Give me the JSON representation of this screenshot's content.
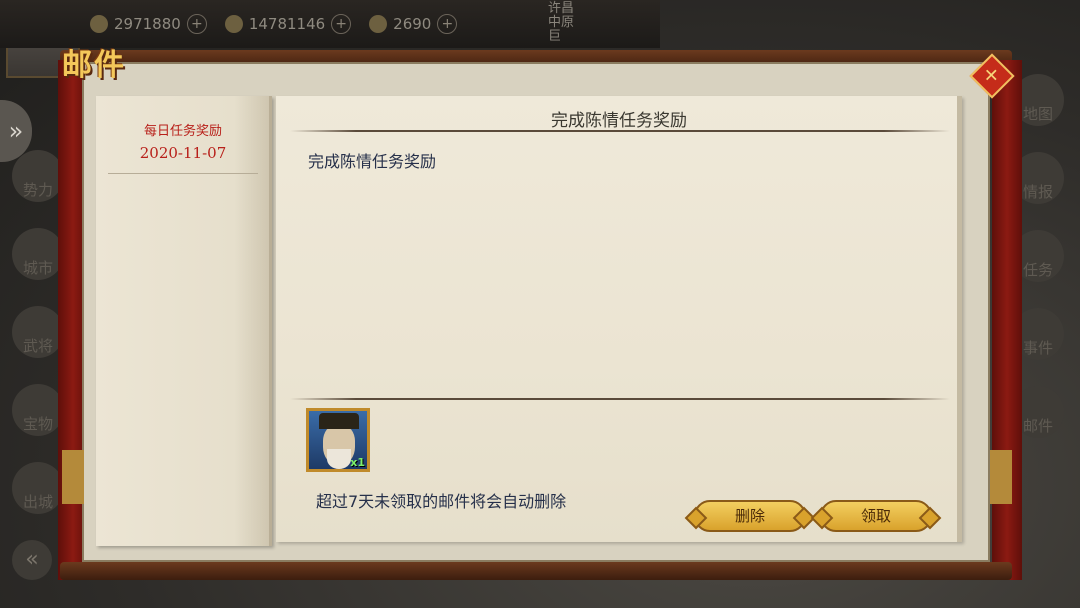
{
  "hud": {
    "resources": [
      {
        "icon": "coin-icon",
        "value": "2971880"
      },
      {
        "icon": "grain-icon",
        "value": "14781146"
      },
      {
        "icon": "gold-ingot-icon",
        "value": "2690"
      }
    ],
    "location": "许昌 中原 巨"
  },
  "left_menu": [
    "势力",
    "城市",
    "武将",
    "宝物",
    "出城"
  ],
  "right_menu": [
    "地图",
    "情报",
    "任务",
    "事件",
    "邮件"
  ],
  "mail_window": {
    "title": "邮件",
    "list": [
      {
        "title": "每日任务奖励",
        "date": "2020-11-07"
      }
    ],
    "detail": {
      "header": "完成陈情任务奖励",
      "body": "完成陈情任务奖励",
      "attachments": [
        {
          "icon": "general-portrait-icon",
          "quantity": "x1"
        }
      ],
      "notice": "超过7天未领取的邮件将会自动删除",
      "delete_label": "删除",
      "claim_label": "领取"
    }
  },
  "colors": {
    "title_gold": "#f4c85a",
    "list_red": "#b8201a",
    "button_gold": "#e3b446",
    "text_navy": "#26304a"
  }
}
